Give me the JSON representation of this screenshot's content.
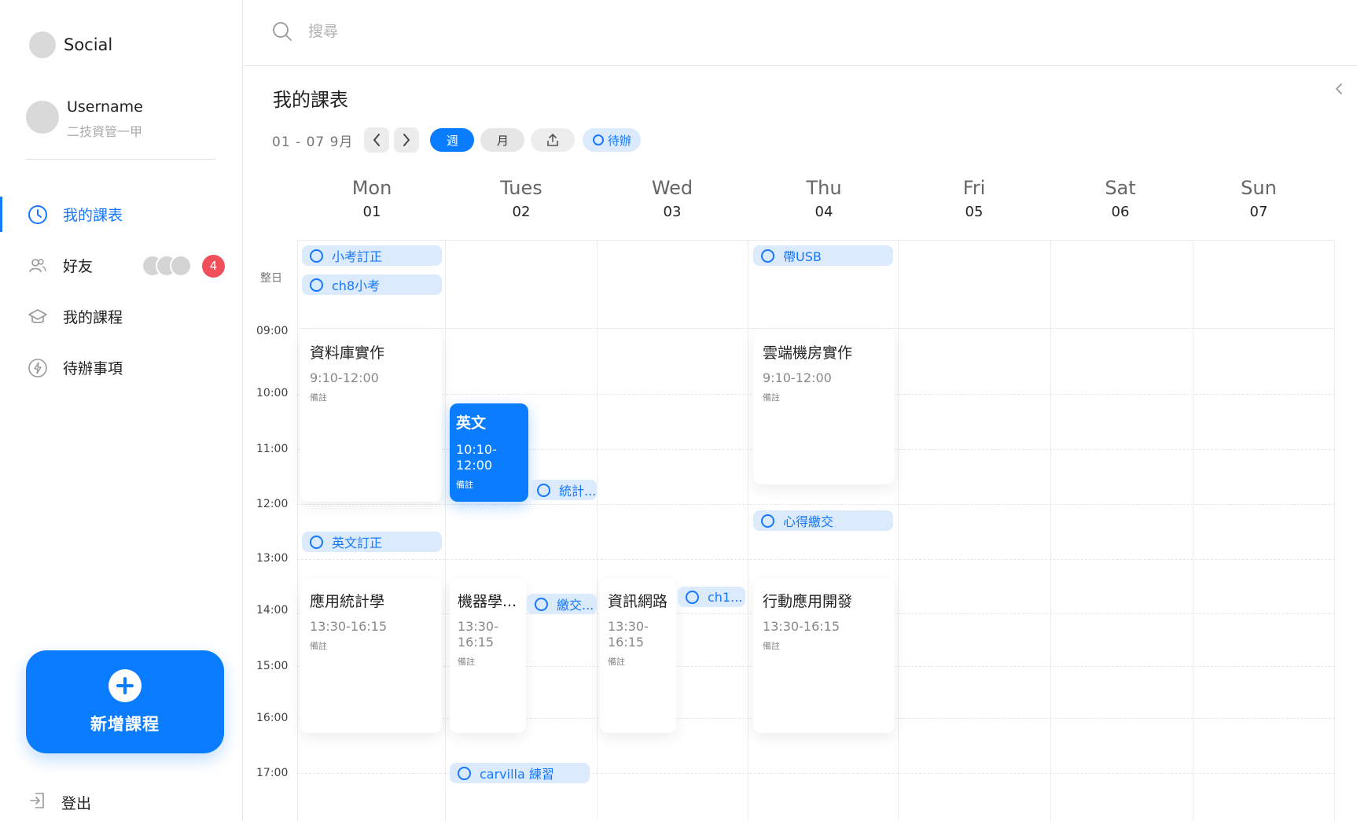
{
  "sidebar": {
    "brand": "Social",
    "user": {
      "name": "Username",
      "subtitle": "二技資管一甲"
    },
    "nav": [
      {
        "label": "我的課表",
        "icon": "clock-icon",
        "active": true
      },
      {
        "label": "好友",
        "icon": "users-icon",
        "badge": "4"
      },
      {
        "label": "我的課程",
        "icon": "graduation-cap-icon"
      },
      {
        "label": "待辦事項",
        "icon": "lightning-icon"
      }
    ],
    "add_course_label": "新增課程",
    "logout_label": "登出"
  },
  "search": {
    "placeholder": "搜尋"
  },
  "main": {
    "title": "我的課表",
    "date_range": "01 - 07 9月",
    "view_week": "週",
    "view_month": "月",
    "todo_filter": "待辦"
  },
  "days": [
    {
      "name": "Mon",
      "num": "01"
    },
    {
      "name": "Tues",
      "num": "02"
    },
    {
      "name": "Wed",
      "num": "03"
    },
    {
      "name": "Thu",
      "num": "04"
    },
    {
      "name": "Fri",
      "num": "05"
    },
    {
      "name": "Sat",
      "num": "06"
    },
    {
      "name": "Sun",
      "num": "07"
    }
  ],
  "allday_label": "整日",
  "times": [
    "09:00",
    "10:00",
    "11:00",
    "12:00",
    "13:00",
    "14:00",
    "15:00",
    "16:00",
    "17:00"
  ],
  "events": [
    {
      "title": "資料庫實作",
      "time": "9:10-12:00",
      "note": "備註"
    },
    {
      "title": "雲端機房實作",
      "time": "9:10-12:00",
      "note": "備註"
    },
    {
      "title": "英文",
      "time": "10:10-12:00",
      "note": "備註"
    },
    {
      "title": "應用統計學",
      "time": "13:30-16:15",
      "note": "備註"
    },
    {
      "title": "機器學...",
      "time": "13:30-16:15",
      "note": "備註"
    },
    {
      "title": "資訊網路",
      "time": "13:30-16:15",
      "note": "備註"
    },
    {
      "title": "行動應用開發",
      "time": "13:30-16:15",
      "note": "備註"
    }
  ],
  "todos": [
    "小考訂正",
    "ch8小考",
    "帶USB",
    "統計...",
    "心得繳交",
    "英文訂正",
    "繳交...",
    "ch1...",
    "carvilla 練習"
  ]
}
